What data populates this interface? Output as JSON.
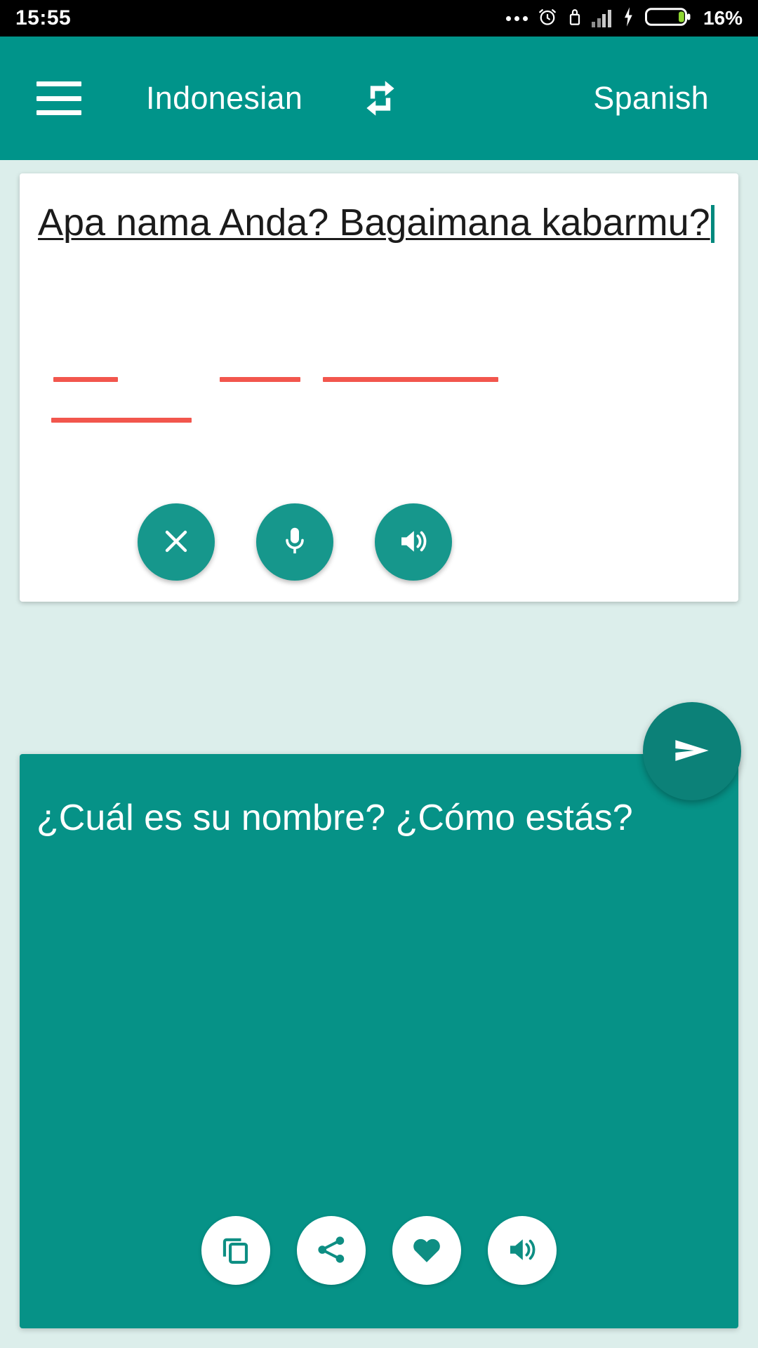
{
  "statusbar": {
    "time": "15:55",
    "battery_percent": "16%",
    "icons": [
      "more-dots-icon",
      "alarm-clock-icon",
      "lock-icon",
      "signal-bars-icon",
      "charging-bolt-icon",
      "battery-icon"
    ]
  },
  "appbar": {
    "menu_icon": "hamburger-menu-icon",
    "source_language": "Indonesian",
    "swap_icon": "swap-languages-icon",
    "target_language": "Spanish"
  },
  "input": {
    "text": "Apa nama Anda? Bagaimana kabarmu?",
    "line1": "Apa nama Anda? Bagaimana",
    "line2": "kabarmu?",
    "misspelled": [
      "Apa",
      "Anda?",
      "Bagaimana",
      "kabarmu"
    ],
    "caret_visible": true,
    "actions": [
      {
        "name": "clear-button",
        "icon": "close-x-icon",
        "label": "Clear"
      },
      {
        "name": "voice-input-button",
        "icon": "microphone-icon",
        "label": "Voice input"
      },
      {
        "name": "speak-source-button",
        "icon": "speaker-icon",
        "label": "Listen"
      }
    ]
  },
  "send": {
    "name": "translate-send-button",
    "icon": "send-icon",
    "label": "Translate"
  },
  "output": {
    "text": "¿Cuál es su nombre? ¿Cómo estás?",
    "actions": [
      {
        "name": "copy-button",
        "icon": "copy-icon",
        "label": "Copy"
      },
      {
        "name": "share-button",
        "icon": "share-icon",
        "label": "Share"
      },
      {
        "name": "favorite-button",
        "icon": "heart-icon",
        "label": "Favorite"
      },
      {
        "name": "speak-target-button",
        "icon": "speaker-icon",
        "label": "Listen"
      }
    ]
  },
  "colors": {
    "teal_primary": "#00948a",
    "teal_card": "#069287",
    "teal_fab": "#16978c",
    "teal_send": "#0c8178",
    "background": "#dceeeb",
    "spellcheck_red": "#f2564d",
    "battery_green": "#8ed632"
  }
}
